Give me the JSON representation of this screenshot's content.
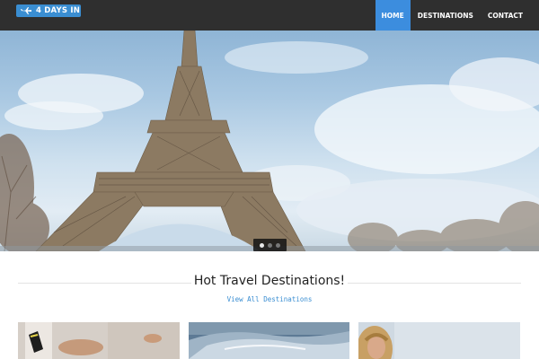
{
  "header": {
    "logo_text": "4 DAYS IN",
    "nav": [
      {
        "label": "HOME",
        "active": true
      },
      {
        "label": "DESTINATIONS",
        "active": false
      },
      {
        "label": "CONTACT",
        "active": false
      }
    ],
    "colors": {
      "bar": "#2f2f2f",
      "accent": "#3c8dde"
    }
  },
  "hero": {
    "image": "eiffel-tower-photo",
    "slider": {
      "count": 3,
      "active_index": 0
    }
  },
  "section": {
    "title": "Hot Travel Destinations!",
    "link": "View All Destinations"
  },
  "cards": [
    {
      "image": "woman-in-sneakers-photo"
    },
    {
      "image": "ocean-wave-photo"
    },
    {
      "image": "blonde-woman-photo"
    }
  ]
}
